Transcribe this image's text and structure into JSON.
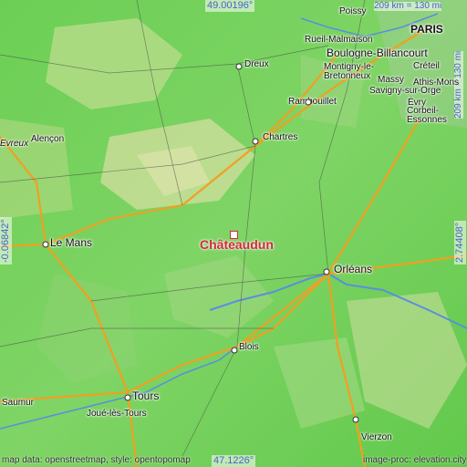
{
  "map": {
    "highlight": {
      "name": "Châteaudun"
    },
    "cities": [
      {
        "name": "PARIS",
        "style": "bold"
      },
      {
        "name": "Boulogne-Billancourt",
        "style": "big"
      },
      {
        "name": "Rueil-Malmaison"
      },
      {
        "name": "Montigny-le-Bretonneux"
      },
      {
        "name": "Massy"
      },
      {
        "name": "Savigny-sur-Orge"
      },
      {
        "name": "Créteil"
      },
      {
        "name": "Athis-Mons"
      },
      {
        "name": "Évry"
      },
      {
        "name": "Corbeil-Essonnes"
      },
      {
        "name": "Poissy"
      },
      {
        "name": "Dreux"
      },
      {
        "name": "Rambouillet"
      },
      {
        "name": "Chartres"
      },
      {
        "name": "Alençon"
      },
      {
        "name": "Le Mans",
        "style": "big"
      },
      {
        "name": "Orléans",
        "style": "big"
      },
      {
        "name": "Blois"
      },
      {
        "name": "Tours",
        "style": "big"
      },
      {
        "name": "Joué-lès-Tours"
      },
      {
        "name": "Saumur"
      },
      {
        "name": "Vierzon"
      },
      {
        "name": "Evreux"
      }
    ],
    "coordinates": {
      "top": "49.00196°",
      "bottom": "47.1226°",
      "left": "-0.06842°",
      "right": "2.74408°"
    },
    "scale": {
      "horizontal": "209 km = 130 mi",
      "vertical": "209 km = 130 mi"
    },
    "attribution": {
      "left": "map data: openstreetmap, style: opentopomap",
      "right": "image-proc: elevation.city"
    },
    "colors": {
      "lowland": "#56c845",
      "midland": "#9ad67a",
      "upland": "#c8dd98",
      "river": "#5a8ee0",
      "road": "#f0a020",
      "marker": "#d8263a",
      "coord_text": "#4a63c8"
    }
  }
}
